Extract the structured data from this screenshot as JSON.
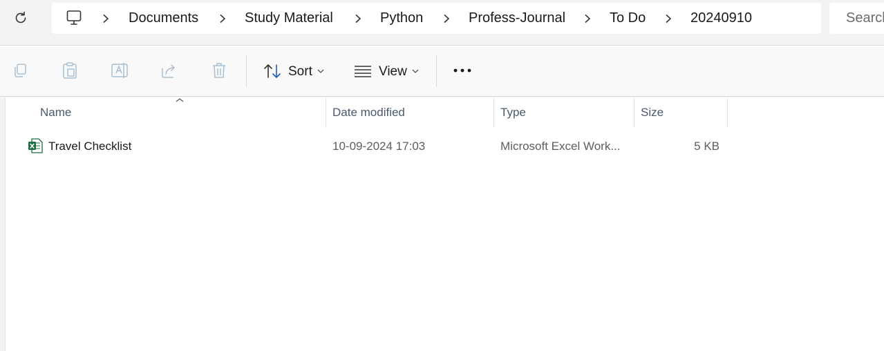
{
  "address": {
    "breadcrumbs": [
      "Documents",
      "Study Material",
      "Python",
      "Profess-Journal",
      "To Do",
      "20240910"
    ],
    "icon": "pc-icon"
  },
  "search": {
    "placeholder": "Search"
  },
  "toolbar": {
    "sort_label": "Sort",
    "view_label": "View",
    "icons": [
      "copy-icon",
      "paste-icon",
      "rename-icon",
      "share-icon",
      "delete-icon",
      "sort-icon",
      "view-icon",
      "more-icon"
    ]
  },
  "columns": {
    "name": "Name",
    "date": "Date modified",
    "type": "Type",
    "size": "Size"
  },
  "files": [
    {
      "name": "Travel Checklist",
      "date": "10-09-2024 17:03",
      "type": "Microsoft Excel Work...",
      "size": "5 KB",
      "icon": "excel-file-icon"
    }
  ],
  "colors": {
    "excel_green": "#1d6f42",
    "disabled_icon": "#a9bfd1",
    "header_text": "#4a5a6a"
  }
}
